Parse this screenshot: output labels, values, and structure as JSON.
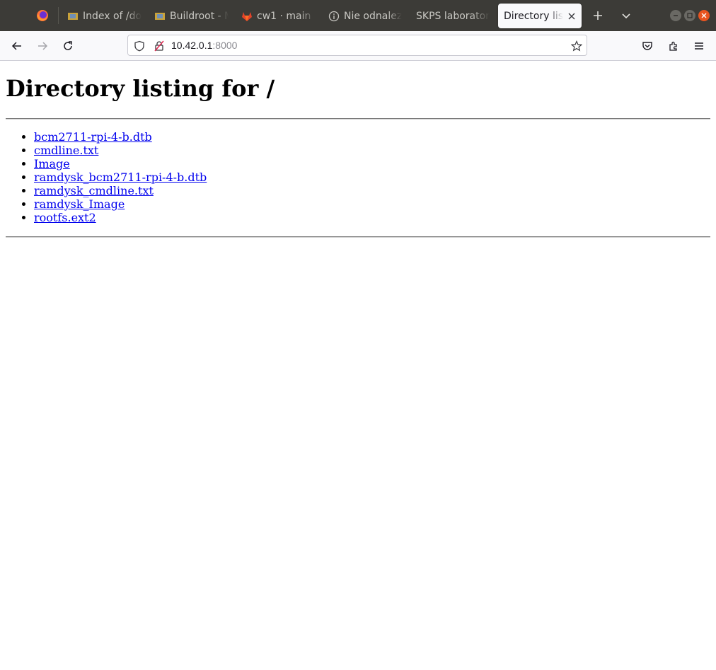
{
  "tabs": [
    {
      "label": "Index of /do",
      "icon": "buildroot-icon"
    },
    {
      "label": "Buildroot - M",
      "icon": "buildroot-icon"
    },
    {
      "label": "cw1 · main ·",
      "icon": "gitlab-icon"
    },
    {
      "label": "Nie odnalez",
      "icon": "info-icon"
    },
    {
      "label": "SKPS laboratori",
      "icon": ""
    },
    {
      "label": "Directory list",
      "icon": "",
      "active": true
    }
  ],
  "address": {
    "host": "10.42.0.1",
    "port": ":8000"
  },
  "page": {
    "heading": "Directory listing for /",
    "files": [
      "bcm2711-rpi-4-b.dtb",
      "cmdline.txt",
      "Image",
      "ramdysk_bcm2711-rpi-4-b.dtb",
      "ramdysk_cmdline.txt",
      "ramdysk_Image",
      "rootfs.ext2"
    ]
  },
  "colors": {
    "titlebar": "#3c3b37",
    "link": "#0000ee",
    "close_button": "#e95420"
  }
}
